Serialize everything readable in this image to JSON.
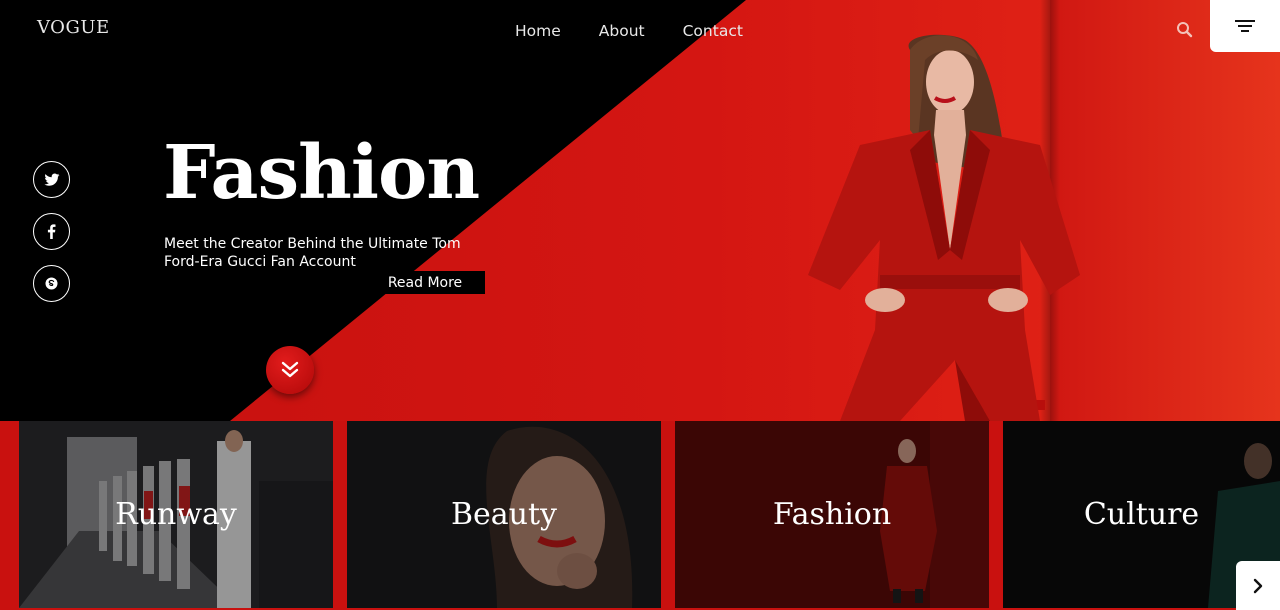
{
  "header": {
    "logo": "VOGUE",
    "nav": [
      {
        "label": "Home"
      },
      {
        "label": "About"
      },
      {
        "label": "Contact"
      }
    ]
  },
  "social": [
    {
      "icon": "twitter-icon"
    },
    {
      "icon": "facebook-icon"
    },
    {
      "icon": "skype-icon"
    }
  ],
  "hero": {
    "title": "Fashion",
    "subtitle": "Meet the Creator Behind the Ultimate Tom Ford-Era Gucci Fan Account",
    "cta": "Read More"
  },
  "categories": [
    {
      "label": "Runway"
    },
    {
      "label": "Beauty"
    },
    {
      "label": "Fashion"
    },
    {
      "label": "Culture"
    }
  ],
  "colors": {
    "accent": "#d41612",
    "background": "#000000",
    "text": "#ffffff"
  }
}
